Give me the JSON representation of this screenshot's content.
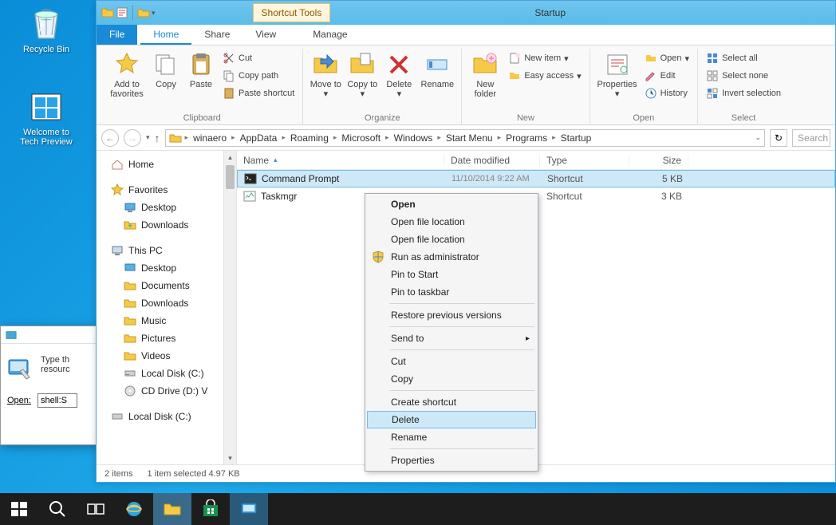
{
  "desktop": {
    "recycle": "Recycle Bin",
    "techpreview": "Welcome to Tech Preview"
  },
  "run": {
    "text": "Type the name of a program, folder, document, or Internet resource, and Windows will open it for you.",
    "text_short": "Type th",
    "text_line2": "resourc",
    "open_label": "Open:",
    "value": "shell:S"
  },
  "explorer": {
    "title_context_tab": "Shortcut Tools",
    "window_title": "Startup",
    "ribbon_tabs": {
      "file": "File",
      "home": "Home",
      "share": "Share",
      "view": "View",
      "manage": "Manage"
    },
    "ribbon": {
      "clipboard": {
        "addfav": "Add to favorites",
        "copy": "Copy",
        "paste": "Paste",
        "cut": "Cut",
        "copypath": "Copy path",
        "pasteshortcut": "Paste shortcut",
        "title": "Clipboard"
      },
      "organize": {
        "moveto": "Move to",
        "copyto": "Copy to",
        "delete": "Delete",
        "rename": "Rename",
        "title": "Organize"
      },
      "new": {
        "newfolder": "New folder",
        "newitem": "New item",
        "easyaccess": "Easy access",
        "title": "New"
      },
      "open": {
        "properties": "Properties",
        "open": "Open",
        "edit": "Edit",
        "history": "History",
        "title": "Open"
      },
      "select": {
        "selectall": "Select all",
        "selectnone": "Select none",
        "invert": "Invert selection",
        "title": "Select"
      }
    },
    "breadcrumbs": [
      "winaero",
      "AppData",
      "Roaming",
      "Microsoft",
      "Windows",
      "Start Menu",
      "Programs",
      "Startup"
    ],
    "search_placeholder": "Search",
    "sidebar": {
      "home": "Home",
      "favorites": "Favorites",
      "desktop": "Desktop",
      "downloads": "Downloads",
      "thispc": "This PC",
      "desktop2": "Desktop",
      "documents": "Documents",
      "downloads2": "Downloads",
      "music": "Music",
      "pictures": "Pictures",
      "videos": "Videos",
      "localc": "Local Disk (C:)",
      "cddrive": "CD Drive (D:) V",
      "localc2": "Local Disk (C:)"
    },
    "columns": {
      "name": "Name",
      "date": "Date modified",
      "type": "Type",
      "size": "Size"
    },
    "files": [
      {
        "name": "Command Prompt",
        "date": "11/10/2014 9:22 AM",
        "type": "Shortcut",
        "size": "5 KB"
      },
      {
        "name": "Taskmgr",
        "date": "",
        "type": "Shortcut",
        "size": "3 KB"
      }
    ],
    "status": {
      "count": "2 items",
      "selected": "1 item selected  4.97 KB"
    }
  },
  "context_menu": {
    "open": "Open",
    "openloc": "Open file location",
    "openloc2": "Open file location",
    "runadmin": "Run as administrator",
    "pinstart": "Pin to Start",
    "pintaskbar": "Pin to taskbar",
    "restore": "Restore previous versions",
    "sendto": "Send to",
    "cut": "Cut",
    "copy": "Copy",
    "createshortcut": "Create shortcut",
    "delete": "Delete",
    "rename": "Rename",
    "properties": "Properties"
  }
}
